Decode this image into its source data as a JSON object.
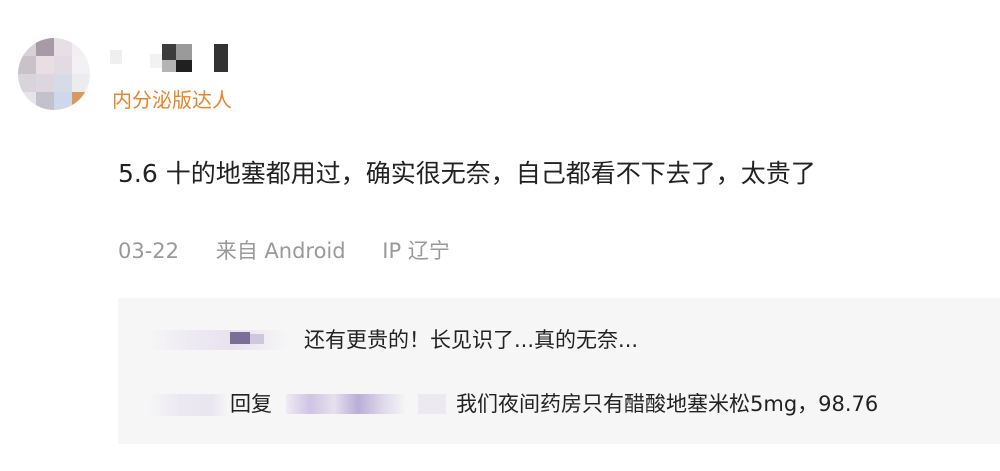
{
  "comment": {
    "badge": "内分泌版达人",
    "text": "5.6 十的地塞都用过，确实很无奈，自己都看不下去了，太贵了",
    "date": "03-22",
    "source": "来自 Android",
    "ip": "IP 辽宁"
  },
  "replies": [
    {
      "text": "还有更贵的！长见识了...真的无奈..."
    },
    {
      "reply_label": "回复",
      "text": "我们夜间药房只有醋酸地塞米松5mg，98.76"
    }
  ],
  "colors": {
    "badge": "#e8842c",
    "meta": "#999999",
    "reply_bg": "#f6f6f6"
  }
}
